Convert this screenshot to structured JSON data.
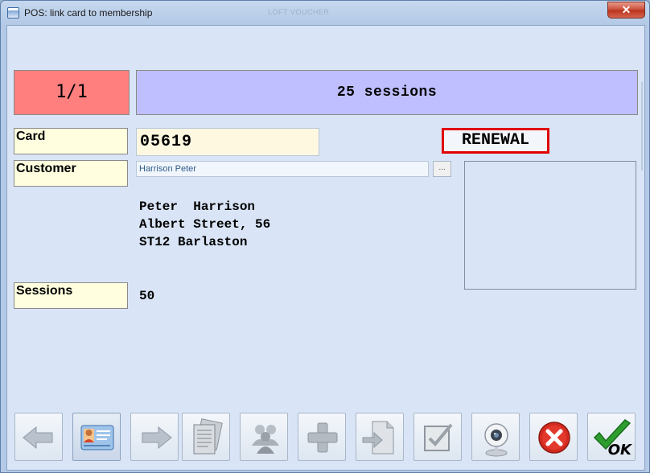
{
  "window": {
    "title": "POS: link card to membership",
    "background_caption": "LOFT VOUCHER",
    "close_glyph": "✕"
  },
  "header": {
    "counter": "1/1",
    "product": "25 sessions",
    "counter_color": "#ff7f7f",
    "product_color": "#bfbfff"
  },
  "form": {
    "card_label": "Card",
    "card_value": "05619",
    "status_badge": "RENEWAL",
    "customer_label": "Customer",
    "customer_value": "Harrison Peter",
    "browse_label": "...",
    "address_lines": [
      "Peter  Harrison",
      "Albert Street, 56",
      "ST12 Barlaston"
    ],
    "sessions_label": "Sessions",
    "sessions_value": "50"
  },
  "toolbar": {
    "buttons": [
      {
        "name": "previous-button",
        "icon": "arrow-left-icon"
      },
      {
        "name": "customer-card-button",
        "icon": "id-card-icon"
      },
      {
        "name": "next-button",
        "icon": "arrow-right-icon"
      },
      {
        "name": "documents-button",
        "icon": "documents-icon"
      },
      {
        "name": "group-button",
        "icon": "people-group-icon"
      },
      {
        "name": "add-button",
        "icon": "plus-icon"
      },
      {
        "name": "export-button",
        "icon": "document-arrow-icon"
      },
      {
        "name": "checklist-button",
        "icon": "checkbox-icon"
      },
      {
        "name": "webcam-button",
        "icon": "webcam-icon"
      },
      {
        "name": "cancel-button",
        "icon": "cancel-icon"
      },
      {
        "name": "ok-button",
        "icon": "checkmark-icon"
      }
    ],
    "ok_label": "OK"
  }
}
